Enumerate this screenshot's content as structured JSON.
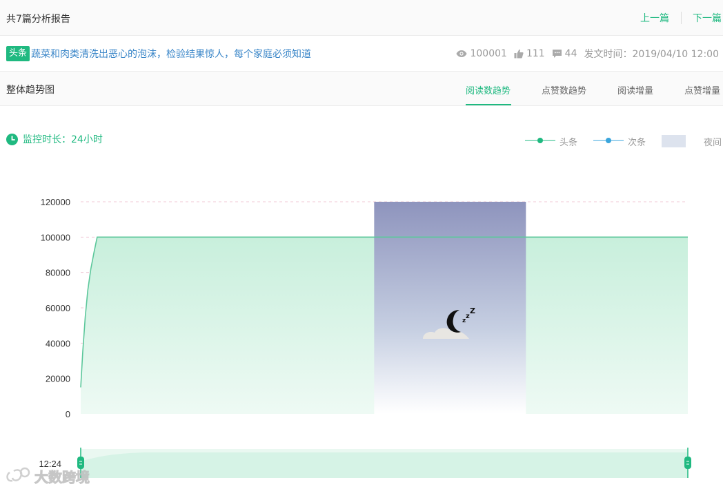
{
  "header": {
    "report_count": "共7篇分析报告",
    "prev_label": "上一篇",
    "next_label": "下一篇"
  },
  "article": {
    "badge": "头条",
    "title": "蔬菜和肉类清洗出恶心的泡沫，检验结果惊人，每个家庭必须知道",
    "views": "100001",
    "likes": "111",
    "comments": "44",
    "publish_time": "发文时间：2019/04/10 12:00"
  },
  "section": {
    "title": "整体趋势图",
    "tabs": [
      {
        "label": "阅读数趋势",
        "active": true
      },
      {
        "label": "点赞数趋势",
        "active": false
      },
      {
        "label": "阅读增量",
        "active": false
      },
      {
        "label": "点赞增量",
        "active": false
      }
    ]
  },
  "monitor": {
    "label": "监控时长：24小时"
  },
  "legend": {
    "items": [
      {
        "label": "头条",
        "color": "#1fb980"
      },
      {
        "label": "次条",
        "color": "#3aa5dc"
      },
      {
        "label": "夜间",
        "color": "#dde3ee"
      }
    ]
  },
  "slider": {
    "start_label": "12:24"
  },
  "watermark": "大数跨境",
  "colors": {
    "accent": "#1fb980",
    "link": "#3a86c8",
    "night_top": "#8e94bd",
    "area_fill": "#d6f3e6"
  },
  "chart_data": {
    "type": "area",
    "series": [
      {
        "name": "头条",
        "x": [
          0,
          0.08,
          0.18,
          0.28,
          0.4,
          0.52,
          0.65,
          1,
          2,
          24
        ],
        "values": [
          15000,
          35000,
          55000,
          70000,
          82000,
          91000,
          100000,
          100000,
          100000,
          100000
        ]
      }
    ],
    "y_ticks": [
      0,
      20000,
      40000,
      60000,
      80000,
      100000,
      120000
    ],
    "ylim": [
      0,
      120000
    ],
    "xlim": [
      0,
      24
    ],
    "night_band": [
      11.6,
      17.6
    ],
    "grid": true,
    "legend_position": "top-right"
  }
}
